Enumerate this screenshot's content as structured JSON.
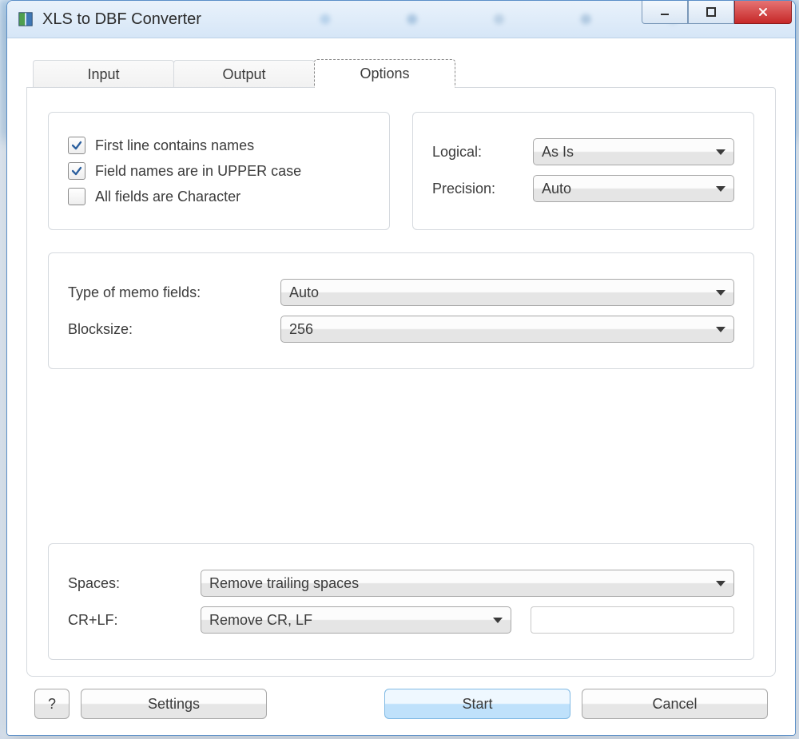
{
  "window": {
    "title": "XLS to DBF Converter"
  },
  "tabs": {
    "input": "Input",
    "output": "Output",
    "options": "Options",
    "active": "options"
  },
  "options": {
    "checks": {
      "first_line_names": {
        "label": "First line contains names",
        "checked": true
      },
      "upper_case": {
        "label": "Field names are in UPPER case",
        "checked": true
      },
      "all_char": {
        "label": "All fields are Character",
        "checked": false
      }
    },
    "logical": {
      "label": "Logical:",
      "value": "As Is"
    },
    "precision": {
      "label": "Precision:",
      "value": "Auto"
    },
    "memo_type": {
      "label": "Type of memo fields:",
      "value": "Auto"
    },
    "blocksize": {
      "label": "Blocksize:",
      "value": "256"
    },
    "spaces": {
      "label": "Spaces:",
      "value": "Remove trailing spaces"
    },
    "crlf": {
      "label": "CR+LF:",
      "value": "Remove CR, LF",
      "replace_with": ""
    }
  },
  "footer": {
    "help": "?",
    "settings": "Settings",
    "start": "Start",
    "cancel": "Cancel"
  }
}
